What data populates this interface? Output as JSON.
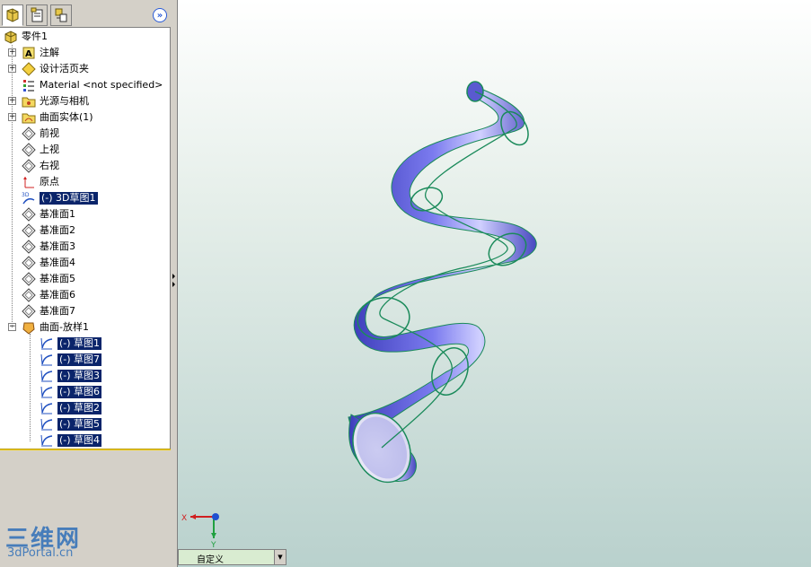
{
  "feature_tree": {
    "root": {
      "label": "零件1",
      "icon": "part-icon"
    },
    "items": [
      {
        "label": "注解",
        "icon": "annotation-icon",
        "expandable": true
      },
      {
        "label": "设计活页夹",
        "icon": "design-binder-icon",
        "expandable": true
      },
      {
        "label": "Material <not specified>",
        "icon": "material-icon",
        "expandable": false
      },
      {
        "label": "光源与相机",
        "icon": "lights-cameras-icon",
        "expandable": true
      },
      {
        "label": "曲面实体(1)",
        "icon": "surface-bodies-icon",
        "expandable": true
      },
      {
        "label": "前视",
        "icon": "plane-icon",
        "expandable": false
      },
      {
        "label": "上视",
        "icon": "plane-icon",
        "expandable": false
      },
      {
        "label": "右视",
        "icon": "plane-icon",
        "expandable": false
      },
      {
        "label": "原点",
        "icon": "origin-icon",
        "expandable": false
      },
      {
        "label": "(-) 3D草图1",
        "icon": "3d-sketch-icon",
        "expandable": false,
        "selected": true
      },
      {
        "label": "基准面1",
        "icon": "plane-icon",
        "expandable": false
      },
      {
        "label": "基准面2",
        "icon": "plane-icon",
        "expandable": false
      },
      {
        "label": "基准面3",
        "icon": "plane-icon",
        "expandable": false
      },
      {
        "label": "基准面4",
        "icon": "plane-icon",
        "expandable": false
      },
      {
        "label": "基准面5",
        "icon": "plane-icon",
        "expandable": false
      },
      {
        "label": "基准面6",
        "icon": "plane-icon",
        "expandable": false
      },
      {
        "label": "基准面7",
        "icon": "plane-icon",
        "expandable": false
      },
      {
        "label": "曲面-放样1",
        "icon": "surface-loft-icon",
        "expandable": true,
        "expanded": true
      }
    ],
    "loft_children": [
      {
        "label": "(-) 草图1",
        "icon": "sketch-icon",
        "selected": true
      },
      {
        "label": "(-) 草图7",
        "icon": "sketch-icon",
        "selected": true
      },
      {
        "label": "(-) 草图3",
        "icon": "sketch-icon",
        "selected": true
      },
      {
        "label": "(-) 草图6",
        "icon": "sketch-icon",
        "selected": true
      },
      {
        "label": "(-) 草图2",
        "icon": "sketch-icon",
        "selected": true
      },
      {
        "label": "(-) 草图5",
        "icon": "sketch-icon",
        "selected": true
      },
      {
        "label": "(-) 草图4",
        "icon": "sketch-icon",
        "selected": true
      }
    ]
  },
  "tabs": [
    {
      "name": "feature-manager-tab-icon"
    },
    {
      "name": "property-manager-tab-icon"
    },
    {
      "name": "configuration-manager-tab-icon"
    }
  ],
  "viewport": {
    "view_orientation": "自定义",
    "triad": {
      "x_label": "X",
      "y_label": "Y"
    }
  },
  "watermark": {
    "line1": "三维网",
    "line2": "3dPortal.cn"
  },
  "colors": {
    "selection": "#0a246a",
    "surface": "#5858d8",
    "edges": "#1a8a5a",
    "watermark": "#2f6fb8"
  }
}
